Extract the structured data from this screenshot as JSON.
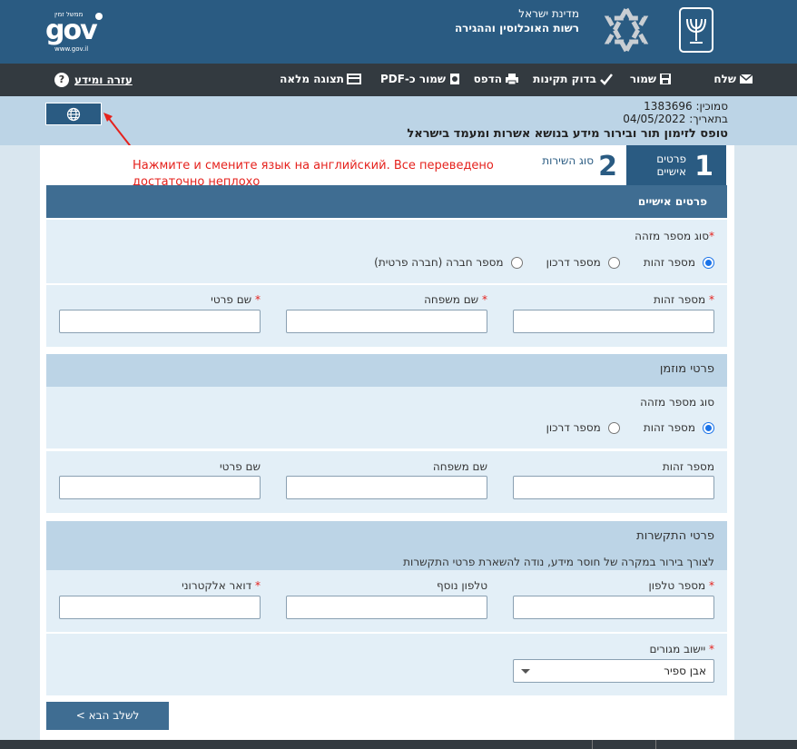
{
  "header": {
    "gov_logo_text": "gov",
    "gov_logo_small": "ממשל זמין",
    "gov_logo_url": "www.gov.il",
    "state_line1": "מדינת ישראל",
    "state_line2": "רשות האוכלוסין וההגירה"
  },
  "toolbar": {
    "send": "שלח",
    "save": "שמור",
    "validate": "בדוק תקינות",
    "print": "הדפס",
    "save_pdf": "שמור כ-PDF",
    "full_view": "תצוגה מלאה",
    "help": "עזרה ומידע",
    "help_icon": "?"
  },
  "info": {
    "reference": "סמוכין: 1383696",
    "date": "בתאריך: 04/05/2022",
    "form_title": "טופס לזימון תור ובירור מידע בנושא אשרות ומעמד בישראל"
  },
  "steps": [
    {
      "number": "1",
      "label_line1": "פרטים",
      "label_line2": "אישיים"
    },
    {
      "number": "2",
      "label": "סוג השירות"
    }
  ],
  "annotation": "Нажмите и смените язык на английский. Все переведено достаточно неплохо",
  "personal": {
    "heading": "פרטים אישיים",
    "id_type_label": "סוג מספר מזהה",
    "required_mark": "*",
    "id_type_options": [
      "מספר זהות",
      "מספר דרכון",
      "מספר חברה (חברה פרטית)"
    ],
    "id_number_label": "מספר זהות",
    "last_name_label": "שם משפחה",
    "first_name_label": "שם פרטי"
  },
  "invitee": {
    "heading": "פרטי מוזמן",
    "id_type_label": "סוג מספר מזהה",
    "id_type_options": [
      "מספר זהות",
      "מספר דרכון"
    ],
    "id_number_label": "מספר זהות",
    "last_name_label": "שם משפחה",
    "first_name_label": "שם פרטי"
  },
  "contact": {
    "heading": "פרטי התקשרות",
    "note": "לצורך בירור במקרה של חוסר מידע, נודה להשארת פרטי התקשרות",
    "phone_label": "מספר טלפון",
    "extra_phone_label": "טלפון נוסף",
    "email_label": "דואר אלקטרוני",
    "settlement_label": "יישוב מגורים",
    "settlement_value": "אבן ספיר"
  },
  "next_button": "לשלב הבא >"
}
